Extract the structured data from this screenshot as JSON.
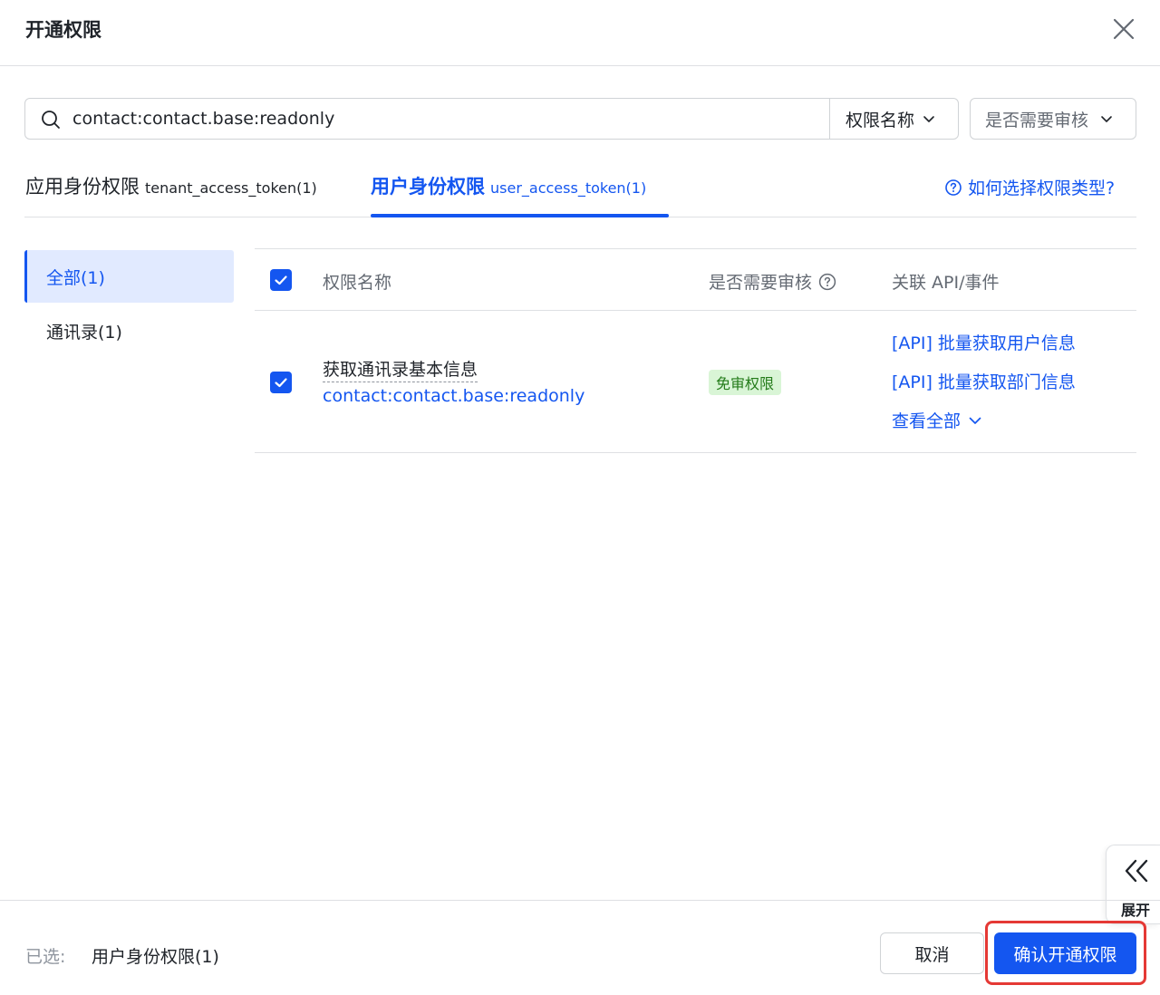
{
  "header": {
    "title": "开通权限",
    "close_icon": "close-icon"
  },
  "search": {
    "value": "contact:contact.base:readonly",
    "field_select": "权限名称",
    "review_select": "是否需要审核"
  },
  "tabs": [
    {
      "label": "应用身份权限",
      "token": "tenant_access_token(1)",
      "active": false
    },
    {
      "label": "用户身份权限",
      "token": "user_access_token(1)",
      "active": true
    }
  ],
  "help_link": "如何选择权限类型?",
  "sidebar": {
    "items": [
      {
        "label": "全部(1)",
        "active": true
      },
      {
        "label": "通讯录(1)",
        "active": false
      }
    ]
  },
  "table": {
    "headers": {
      "name": "权限名称",
      "review": "是否需要审核",
      "related": "关联 API/事件"
    },
    "rows": [
      {
        "checked": true,
        "name": "获取通讯录基本信息",
        "key": "contact:contact.base:readonly",
        "review_badge": "免审权限",
        "apis": [
          "[API] 批量获取用户信息",
          "[API] 批量获取部门信息"
        ],
        "view_all": "查看全部"
      }
    ]
  },
  "footer": {
    "selected_label": "已选:",
    "selected_value": "用户身份权限(1)",
    "cancel": "取消",
    "confirm": "确认开通权限"
  },
  "expand": {
    "label": "展开"
  },
  "colors": {
    "primary": "#1456f0",
    "badge_bg": "#d9f5d6",
    "badge_text": "#237b19",
    "highlight": "#e53935"
  }
}
